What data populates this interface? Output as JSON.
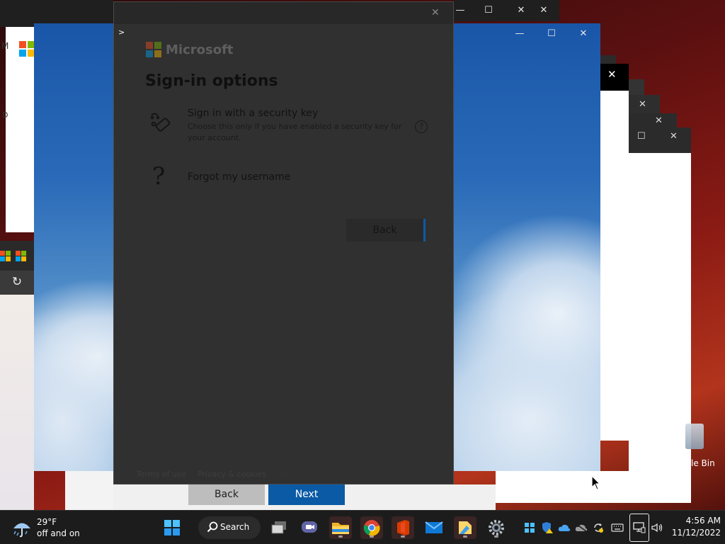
{
  "background_windows": {
    "window_controls": {
      "close": "✕",
      "maximize": "☐",
      "minimize": "—"
    },
    "partial_text_m": "M",
    "partial_text_d": "D",
    "cursor_prompt": ">",
    "recycle_bin_label": "le Bin",
    "dialog_buttons": {
      "back": "Back",
      "next": "Next"
    }
  },
  "dialog": {
    "brand": "Microsoft",
    "title": "Sign-in options",
    "options": [
      {
        "icon": "security-key-icon",
        "title": "Sign in with a security key",
        "description": "Choose this only if you have enabled a security key for your account.",
        "help": "?"
      },
      {
        "icon": "question-mark-icon",
        "title": "Forgot my username"
      }
    ],
    "back_button": "Back",
    "footer": {
      "terms": "Terms of use",
      "privacy": "Privacy & cookies",
      "more": "···"
    },
    "close": "✕"
  },
  "taskbar": {
    "weather": {
      "temp": "29°F",
      "status": "off and on",
      "icon": "rain-umbrella-icon"
    },
    "search_label": "Search",
    "pinned": [
      "start-icon",
      "search-icon",
      "task-view-icon",
      "teams-chat-icon",
      "file-explorer-icon",
      "chrome-icon",
      "office-icon",
      "mail-icon",
      "notes-icon",
      "settings-icon"
    ],
    "tray": [
      "windows-update-icon",
      "defender-warning-icon",
      "onedrive-icon",
      "onedrive-paused-icon",
      "sync-icon",
      "keyboard-icon",
      "network-icon",
      "volume-icon"
    ],
    "clock": {
      "time": "4:56 AM",
      "date": "11/12/2022"
    }
  },
  "colors": {
    "accent": "#0a5aa6",
    "taskbar": "#1c1c1c",
    "dialog_bg": "#303030"
  }
}
